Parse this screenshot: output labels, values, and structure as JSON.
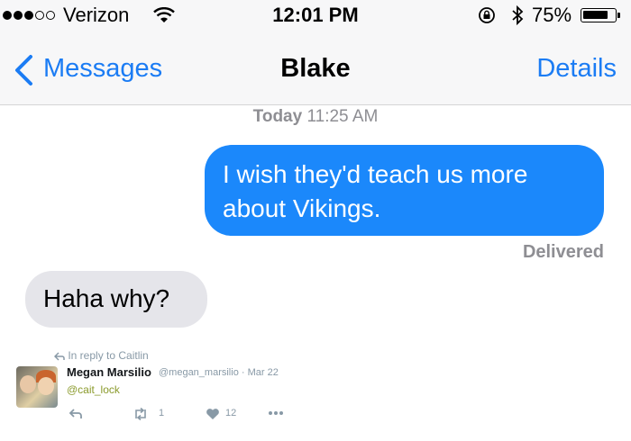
{
  "status_bar": {
    "carrier": "Verizon",
    "time": "12:01 PM",
    "battery_percent": "75%",
    "signal_bars_filled": 3,
    "signal_bars_total": 5
  },
  "nav": {
    "back_label": "Messages",
    "title": "Blake",
    "details_label": "Details"
  },
  "conversation": {
    "timestamp_day": "Today",
    "timestamp_time": "11:25 AM",
    "outgoing_text": "I wish they'd teach us more about Vikings.",
    "delivered_label": "Delivered",
    "incoming_text": "Haha why?"
  },
  "tweet": {
    "reply_context": "In reply to Caitlin",
    "author_name": "Megan Marsilio",
    "author_handle_date": "@megan_marsilio · Mar 22",
    "body_mention": "@cait_lock",
    "retweet_count": "1",
    "like_count": "12"
  },
  "colors": {
    "ios_blue": "#1b7cf4",
    "bubble_blue": "#1b88fb",
    "bubble_gray": "#e5e5ea",
    "mention_green": "#8a9a2b"
  }
}
